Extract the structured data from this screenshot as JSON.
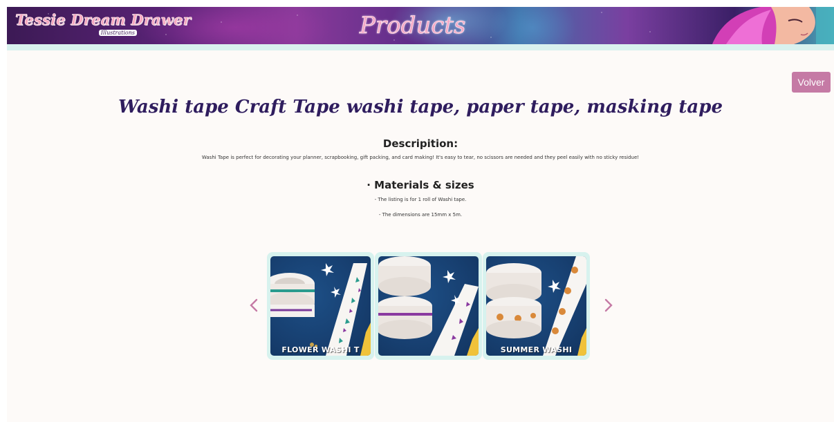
{
  "header": {
    "logo_text": "Tessie Dream Drawer",
    "logo_subtext": "Illustrations",
    "banner_title": "Products"
  },
  "back_button_label": "Volver",
  "product": {
    "title": "Washi tape Craft Tape washi tape, paper tape, masking tape",
    "description_heading": "Descripition:",
    "description_text": "Washi Tape is perfect for decorating your planner, scrapbooking, gift packing, and card making! It's easy to tear, no scissors are needed and they peel easily with no sticky residue!",
    "materials_heading": "· Materials & sizes",
    "materials_items": [
      "- The listing is for 1 roll of Washi tape.",
      "- The dimensions are 15mm x 5m."
    ]
  },
  "carousel": {
    "slides": [
      {
        "caption": "FLOWER WASHI T",
        "tape_color": "#2a9c8e"
      },
      {
        "caption": "",
        "tape_color": "#8a3aa0"
      },
      {
        "caption": "SUMMER WASHI",
        "tape_color": "#d9893a"
      }
    ],
    "prev_icon": "chevron-left-icon",
    "next_icon": "chevron-right-icon"
  },
  "colors": {
    "accent": "#c57aa5",
    "title": "#2f1d5e",
    "banner_strip": "#d9f1ee",
    "page_bg": "#fdfaf8"
  }
}
